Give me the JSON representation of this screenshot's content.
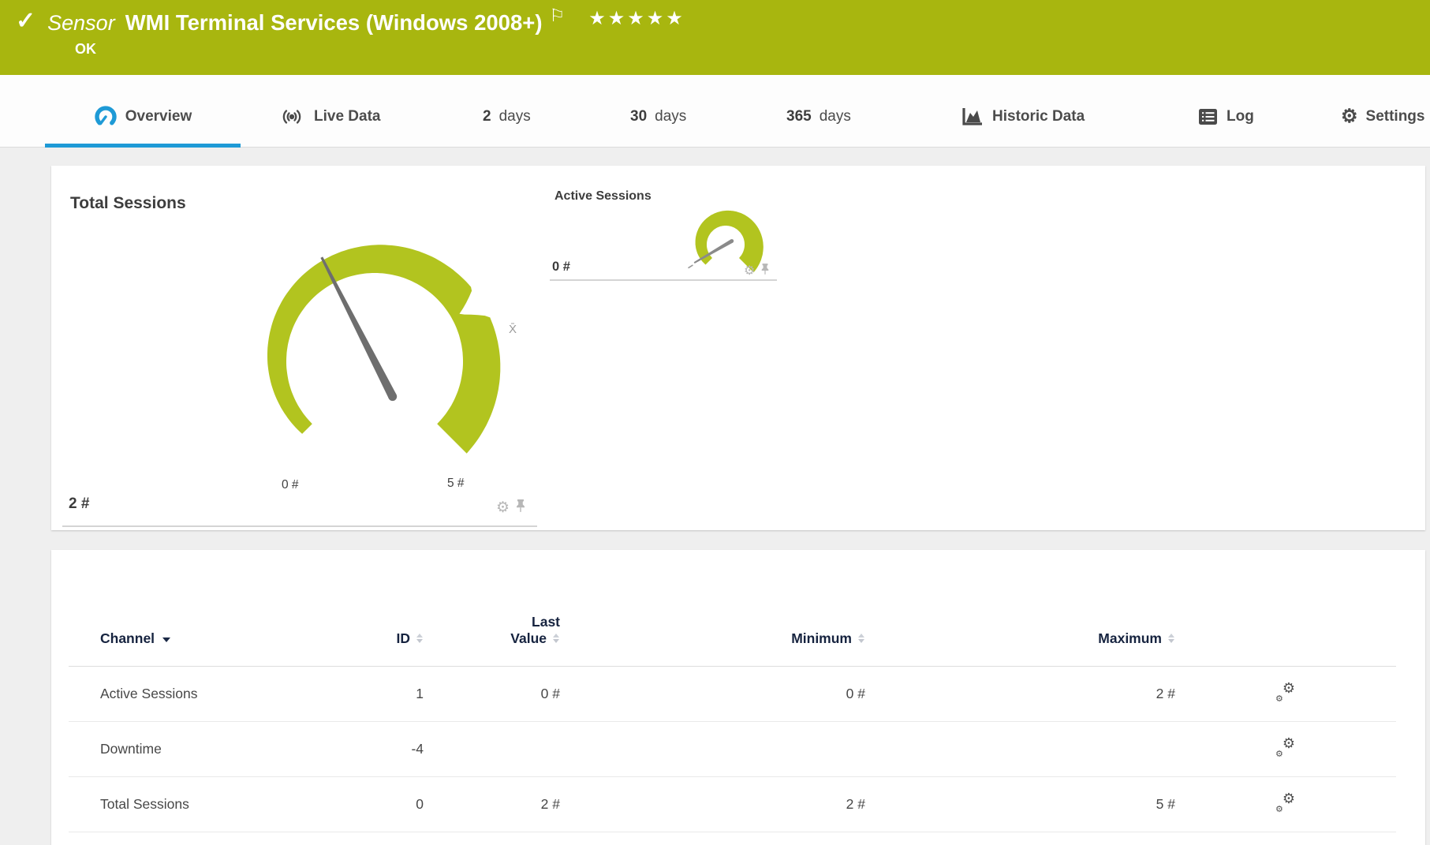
{
  "colors": {
    "status_ok_green": "#a8b60f",
    "gauge_green": "#b2c41f",
    "accent_blue": "#1e9ad6",
    "table_header_navy": "#16233f"
  },
  "glyphs": {
    "check": "✓",
    "flag": "⚐",
    "stars": "★★★★★",
    "gear": "⚙"
  },
  "header": {
    "sensor_label": "Sensor",
    "title": "WMI Terminal Services (Windows 2008+)",
    "status": "OK",
    "rating": "5 of 5 stars"
  },
  "tabs": [
    {
      "label": "Overview",
      "icon": "gauge-icon",
      "active": true
    },
    {
      "label": "Live Data",
      "icon": "broadcast-icon"
    },
    {
      "num": "2",
      "label": "days"
    },
    {
      "num": "30",
      "label": "days"
    },
    {
      "num": "365",
      "label": "days"
    },
    {
      "label": "Historic Data",
      "icon": "area-chart-icon"
    },
    {
      "label": "Log",
      "icon": "log-list-icon"
    },
    {
      "label": "Settings",
      "icon": "gear-icon"
    }
  ],
  "chart_data": [
    {
      "type": "gauge",
      "title": "Total Sessions",
      "unit": "#",
      "min": 0,
      "max": 5,
      "value": 2,
      "value_label": "2 #",
      "scale_min_label": "0 #",
      "scale_max_label": "5 #",
      "avg_marker_label": "X̄",
      "avg_marker_value_est": 3.6,
      "color": "#b2c41f"
    },
    {
      "type": "gauge",
      "title": "Active Sessions",
      "unit": "#",
      "min": 0,
      "max": null,
      "value": 0,
      "value_label": "0 #",
      "color": "#b2c41f"
    }
  ],
  "table": {
    "columns": {
      "channel": "Channel",
      "id": "ID",
      "last_line1": "Last",
      "last_line2": "Value",
      "min": "Minimum",
      "max": "Maximum"
    },
    "rows": [
      {
        "channel": "Active Sessions",
        "id": "1",
        "last": "0 #",
        "min": "0 #",
        "max": "2 #"
      },
      {
        "channel": "Downtime",
        "id": "-4",
        "last": "",
        "min": "",
        "max": ""
      },
      {
        "channel": "Total Sessions",
        "id": "0",
        "last": "2 #",
        "min": "2 #",
        "max": "5 #"
      }
    ]
  }
}
